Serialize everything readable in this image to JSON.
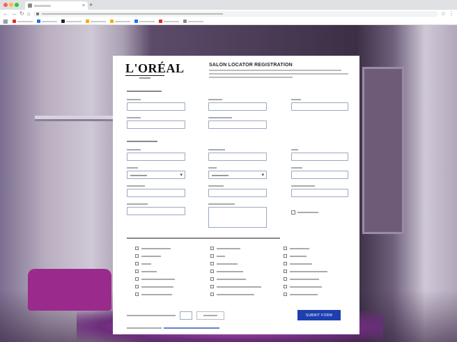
{
  "browser": {
    "tab_title": "",
    "address": "",
    "bookmarks": [
      {
        "label": "",
        "color": "#d93025"
      },
      {
        "label": "",
        "color": "#1a73e8"
      },
      {
        "label": "",
        "color": "#222222"
      },
      {
        "label": "",
        "color": "#f9ab00"
      },
      {
        "label": "",
        "color": "#f9ab00"
      },
      {
        "label": "",
        "color": "#1a73e8"
      },
      {
        "label": "",
        "color": "#d93025"
      },
      {
        "label": "",
        "color": "#888888"
      }
    ]
  },
  "form": {
    "logo": "L'ORÉAL",
    "title": "SALON LOCATOR REGISTRATION",
    "submit_label": "SUBMIT FORM",
    "accent_color": "#1d3fb0"
  }
}
